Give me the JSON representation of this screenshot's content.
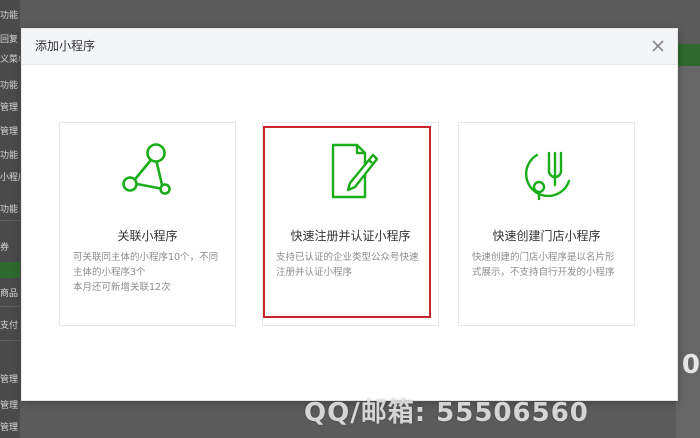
{
  "background": {
    "sidebar_items": [
      "功能",
      "回复",
      "义菜单",
      "功能",
      "管理",
      "管理",
      "功能",
      "小程序",
      "功能",
      "",
      "券",
      "",
      "商品",
      "",
      "支付",
      "",
      "",
      "管理",
      "管理",
      "管理"
    ],
    "right_number": "0"
  },
  "watermark": "QQ/邮箱: 55506560",
  "dialog": {
    "title": "添加小程序",
    "close_label": "×",
    "cards": [
      {
        "icon": "share-network-icon",
        "title": "关联小程序",
        "desc": [
          "可关联同主体的小程序10个，不同",
          "主体的小程序3个",
          "本月还可新增关联12次"
        ]
      },
      {
        "icon": "document-pen-icon",
        "title": "快速注册并认证小程序",
        "desc": [
          "支持已认证的企业类型公众号快速",
          "注册并认证小程序"
        ]
      },
      {
        "icon": "store-fork-pin-icon",
        "title": "快速创建门店小程序",
        "desc": [
          "快速创建的门店小程序是以名片形",
          "式展示，不支持自行开发的小程序"
        ]
      }
    ]
  },
  "colors": {
    "brand_green": "#1aad19",
    "highlight_red": "#c9242b"
  }
}
